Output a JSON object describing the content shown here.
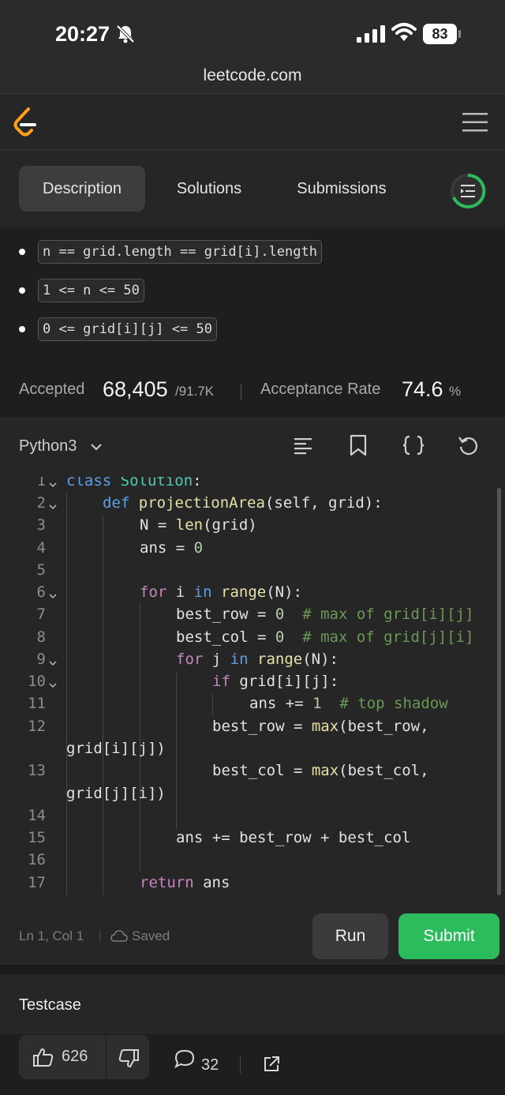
{
  "status_bar": {
    "time": "20:27",
    "battery": "83",
    "url": "leetcode.com"
  },
  "tabs": [
    {
      "label": "Description",
      "active": true
    },
    {
      "label": "Solutions",
      "active": false
    },
    {
      "label": "Submissions",
      "active": false
    }
  ],
  "constraints": [
    "n == grid.length == grid[i].length",
    "1 <= n <= 50",
    "0 <= grid[i][j] <= 50"
  ],
  "stats": {
    "accepted_label": "Accepted",
    "accepted_value": "68,405",
    "accepted_total": "/91.7K",
    "rate_label": "Acceptance Rate",
    "rate_value": "74.6",
    "rate_unit": "%"
  },
  "editor": {
    "language": "Python3",
    "cursor_position": "Ln 1, Col 1",
    "save_status": "Saved",
    "line_numbers": [
      "1",
      "2",
      "3",
      "4",
      "5",
      "6",
      "7",
      "8",
      "9",
      "10",
      "11",
      "12",
      "13",
      "14",
      "15",
      "16",
      "17"
    ],
    "run_label": "Run",
    "submit_label": "Submit"
  },
  "testcase_label": "Testcase",
  "actions": {
    "likes": "626",
    "comments": "32"
  },
  "colors": {
    "accent_green": "#2cbb5d",
    "logo_orange": "#ffa116",
    "keyword_blue": "#5aa0e6",
    "comment_green": "#6a9955"
  }
}
